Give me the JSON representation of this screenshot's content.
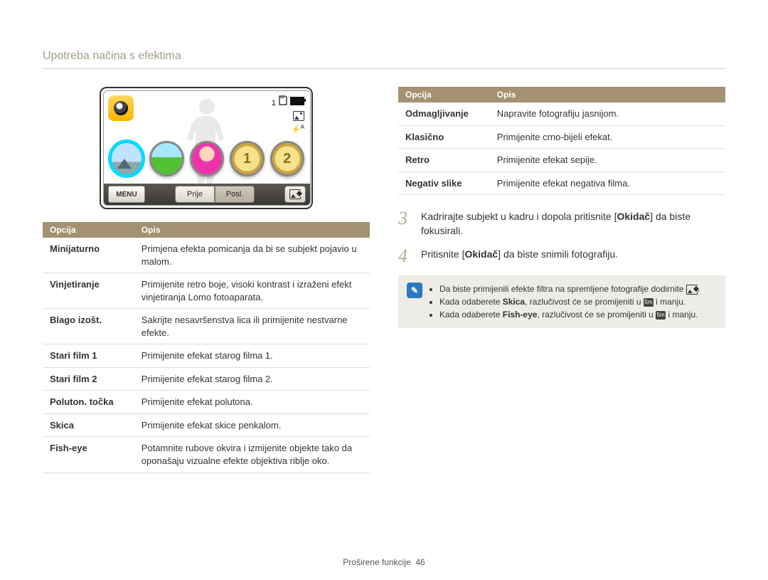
{
  "page_title": "Upotreba načina s efektima",
  "lcd": {
    "status_count": "1",
    "flash_label": "A",
    "menu_label": "MENU",
    "prev_label": "Prije",
    "next_label": "Posl.",
    "coin1": "1",
    "coin2": "2"
  },
  "left_table": {
    "head_option": "Opcija",
    "head_desc": "Opis",
    "rows": [
      {
        "name": "Minijaturno",
        "desc": "Primjena efekta pomicanja da bi se subjekt pojavio u malom."
      },
      {
        "name": "Vinjetiranje",
        "desc": "Primijenite retro boje, visoki kontrast i izraženi efekt vinjetiranja Lomo fotoaparata."
      },
      {
        "name": "Blago izošt.",
        "desc": "Sakrijte nesavršenstva lica ili primijenite nestvarne efekte."
      },
      {
        "name": "Stari film 1",
        "desc": "Primijenite efekat starog filma 1."
      },
      {
        "name": "Stari film 2",
        "desc": "Primijenite efekat starog filma 2."
      },
      {
        "name": "Poluton. točka",
        "desc": "Primijenite efekat polutona."
      },
      {
        "name": "Skica",
        "desc": "Primijenite efekat skice penkalom."
      },
      {
        "name": "Fish-eye",
        "desc": "Potamnite rubove okvira i izmijenite objekte tako da oponašaju vizualne efekte objektiva riblje oko."
      }
    ]
  },
  "right_table": {
    "head_option": "Opcija",
    "head_desc": "Opis",
    "rows": [
      {
        "name": "Odmagljivanje",
        "desc": "Napravite fotografiju jasnijom."
      },
      {
        "name": "Klasično",
        "desc": "Primijenite crno-bijeli efekat."
      },
      {
        "name": "Retro",
        "desc": "Primijenite efekat sepije."
      },
      {
        "name": "Negativ slike",
        "desc": "Primijenite efekat negativa filma."
      }
    ]
  },
  "steps": {
    "s3": {
      "pre": "Kadrirajte subjekt u kadru i dopola pritisnite [",
      "bold": "Okidač",
      "post": "] da biste fokusirali."
    },
    "s4": {
      "pre": "Pritisnite [",
      "bold": "Okidač",
      "post": "] da biste snimili fotografiju."
    }
  },
  "note": {
    "n1": "Da biste primijenili efekte filtra na spremljene fotografije dodirnite ",
    "n1_end": ".",
    "n2_pre": "Kada odaberete ",
    "n2_bold": "Skica",
    "n2_mid": ", razlučivost će se promijeniti u ",
    "n2_end": " i manju.",
    "n3_pre": "Kada odaberete ",
    "n3_bold": "Fish-eye",
    "n3_mid": ", razlučivost će se promijeniti u ",
    "n3_end": " i manju.",
    "size_label": "5m"
  },
  "footer": {
    "section": "Proširene funkcije",
    "page": "46"
  }
}
